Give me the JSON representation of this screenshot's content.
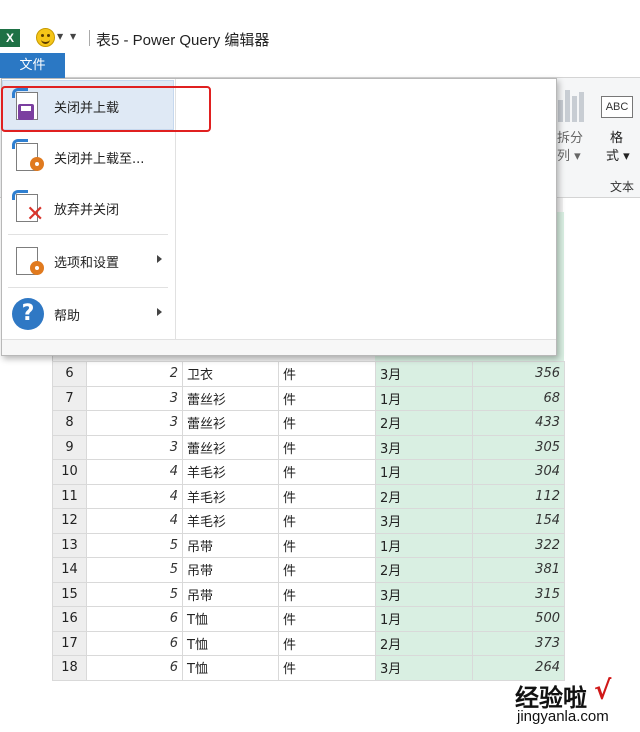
{
  "titlebar": {
    "app_icon": "X",
    "title": "表5 - Power Query 编辑器"
  },
  "file_tab": {
    "label": "文件"
  },
  "file_menu": {
    "items": [
      {
        "label": "关闭并上载",
        "icon": "close-and-load-icon",
        "submenu": false
      },
      {
        "label": "关闭并上载至...",
        "icon": "close-and-load-to-icon",
        "submenu": false
      },
      {
        "label": "放弃并关闭",
        "icon": "discard-and-close-icon",
        "submenu": false
      },
      {
        "label": "选项和设置",
        "icon": "options-settings-icon",
        "submenu": true
      },
      {
        "label": "帮助",
        "icon": "help-icon",
        "submenu": true
      }
    ]
  },
  "ribbon": {
    "split_column": {
      "line1": "拆分",
      "line2": "列"
    },
    "format": {
      "line1": "格",
      "line2": "式",
      "icon_text": "ABC"
    },
    "group_label": "文本"
  },
  "table": {
    "rows": [
      {
        "n": "6",
        "id": "2",
        "name": "卫衣",
        "unit": "件",
        "month": "3月",
        "qty": "356"
      },
      {
        "n": "7",
        "id": "3",
        "name": "蕾丝衫",
        "unit": "件",
        "month": "1月",
        "qty": "68"
      },
      {
        "n": "8",
        "id": "3",
        "name": "蕾丝衫",
        "unit": "件",
        "month": "2月",
        "qty": "433"
      },
      {
        "n": "9",
        "id": "3",
        "name": "蕾丝衫",
        "unit": "件",
        "month": "3月",
        "qty": "305"
      },
      {
        "n": "10",
        "id": "4",
        "name": "羊毛衫",
        "unit": "件",
        "month": "1月",
        "qty": "304"
      },
      {
        "n": "11",
        "id": "4",
        "name": "羊毛衫",
        "unit": "件",
        "month": "2月",
        "qty": "112"
      },
      {
        "n": "12",
        "id": "4",
        "name": "羊毛衫",
        "unit": "件",
        "month": "3月",
        "qty": "154"
      },
      {
        "n": "13",
        "id": "5",
        "name": "吊带",
        "unit": "件",
        "month": "1月",
        "qty": "322"
      },
      {
        "n": "14",
        "id": "5",
        "name": "吊带",
        "unit": "件",
        "month": "2月",
        "qty": "381"
      },
      {
        "n": "15",
        "id": "5",
        "name": "吊带",
        "unit": "件",
        "month": "3月",
        "qty": "315"
      },
      {
        "n": "16",
        "id": "6",
        "name": "T恤",
        "unit": "件",
        "month": "1月",
        "qty": "500"
      },
      {
        "n": "17",
        "id": "6",
        "name": "T恤",
        "unit": "件",
        "month": "2月",
        "qty": "373"
      },
      {
        "n": "18",
        "id": "6",
        "name": "T恤",
        "unit": "件",
        "month": "3月",
        "qty": "264"
      }
    ]
  },
  "watermark": {
    "line1": "经验啦",
    "check": "√",
    "line2": "jingyanla.com"
  },
  "colors": {
    "file_tab": "#2b78c4",
    "highlight": "#e02020",
    "green_cells": "#d9efe2"
  }
}
